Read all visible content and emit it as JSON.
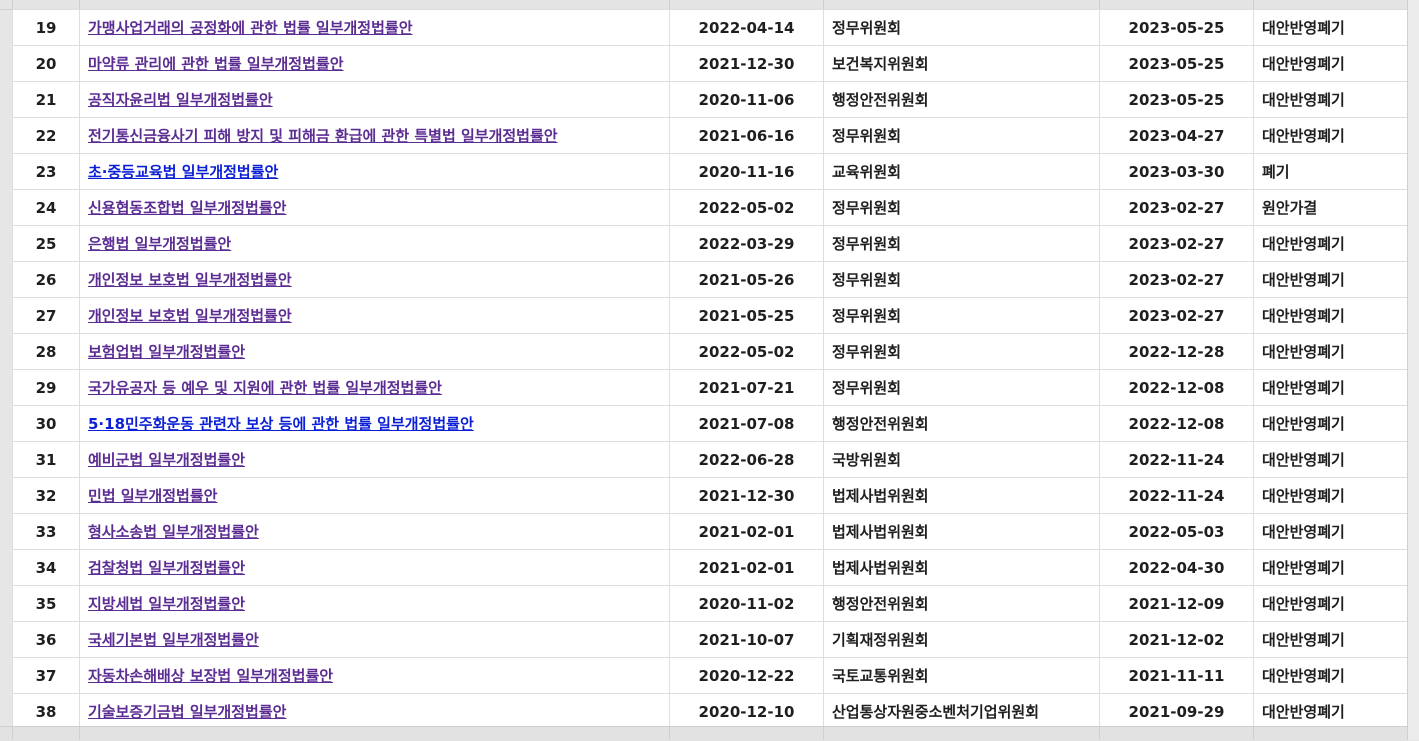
{
  "rows": [
    {
      "no": "19",
      "title": "가맹사업거래의 공정화에 관한 법률 일부개정법률안",
      "proposed": "2022-04-14",
      "committee": "정무위원회",
      "processed": "2023-05-25",
      "result": "대안반영폐기",
      "visited": true
    },
    {
      "no": "20",
      "title": "마약류 관리에 관한 법률 일부개정법률안",
      "proposed": "2021-12-30",
      "committee": "보건복지위원회",
      "processed": "2023-05-25",
      "result": "대안반영폐기",
      "visited": true
    },
    {
      "no": "21",
      "title": "공직자윤리법 일부개정법률안",
      "proposed": "2020-11-06",
      "committee": "행정안전위원회",
      "processed": "2023-05-25",
      "result": "대안반영폐기",
      "visited": true
    },
    {
      "no": "22",
      "title": "전기통신금융사기 피해 방지 및 피해금 환급에 관한 특별법 일부개정법률안",
      "proposed": "2021-06-16",
      "committee": "정무위원회",
      "processed": "2023-04-27",
      "result": "대안반영폐기",
      "visited": true
    },
    {
      "no": "23",
      "title": "초·중등교육법 일부개정법률안",
      "proposed": "2020-11-16",
      "committee": "교육위원회",
      "processed": "2023-03-30",
      "result": "폐기",
      "visited": false
    },
    {
      "no": "24",
      "title": "신용협동조합법 일부개정법률안",
      "proposed": "2022-05-02",
      "committee": "정무위원회",
      "processed": "2023-02-27",
      "result": "원안가결",
      "visited": true
    },
    {
      "no": "25",
      "title": "은행법 일부개정법률안",
      "proposed": "2022-03-29",
      "committee": "정무위원회",
      "processed": "2023-02-27",
      "result": "대안반영폐기",
      "visited": true
    },
    {
      "no": "26",
      "title": "개인정보 보호법 일부개정법률안",
      "proposed": "2021-05-26",
      "committee": "정무위원회",
      "processed": "2023-02-27",
      "result": "대안반영폐기",
      "visited": true
    },
    {
      "no": "27",
      "title": "개인정보 보호법 일부개정법률안",
      "proposed": "2021-05-25",
      "committee": "정무위원회",
      "processed": "2023-02-27",
      "result": "대안반영폐기",
      "visited": true
    },
    {
      "no": "28",
      "title": "보험업법 일부개정법률안",
      "proposed": "2022-05-02",
      "committee": "정무위원회",
      "processed": "2022-12-28",
      "result": "대안반영폐기",
      "visited": true
    },
    {
      "no": "29",
      "title": "국가유공자 등 예우 및 지원에 관한 법률 일부개정법률안",
      "proposed": "2021-07-21",
      "committee": "정무위원회",
      "processed": "2022-12-08",
      "result": "대안반영폐기",
      "visited": true
    },
    {
      "no": "30",
      "title": "5·18민주화운동 관련자 보상 등에 관한 법률 일부개정법률안",
      "proposed": "2021-07-08",
      "committee": "행정안전위원회",
      "processed": "2022-12-08",
      "result": "대안반영폐기",
      "visited": false
    },
    {
      "no": "31",
      "title": "예비군법 일부개정법률안",
      "proposed": "2022-06-28",
      "committee": "국방위원회",
      "processed": "2022-11-24",
      "result": "대안반영폐기",
      "visited": true
    },
    {
      "no": "32",
      "title": "민법 일부개정법률안",
      "proposed": "2021-12-30",
      "committee": "법제사법위원회",
      "processed": "2022-11-24",
      "result": "대안반영폐기",
      "visited": true
    },
    {
      "no": "33",
      "title": "형사소송법 일부개정법률안",
      "proposed": "2021-02-01",
      "committee": "법제사법위원회",
      "processed": "2022-05-03",
      "result": "대안반영폐기",
      "visited": true
    },
    {
      "no": "34",
      "title": "검찰청법 일부개정법률안",
      "proposed": "2021-02-01",
      "committee": "법제사법위원회",
      "processed": "2022-04-30",
      "result": "대안반영폐기",
      "visited": true
    },
    {
      "no": "35",
      "title": "지방세법 일부개정법률안",
      "proposed": "2020-11-02",
      "committee": "행정안전위원회",
      "processed": "2021-12-09",
      "result": "대안반영폐기",
      "visited": true
    },
    {
      "no": "36",
      "title": "국세기본법 일부개정법률안",
      "proposed": "2021-10-07",
      "committee": "기획재정위원회",
      "processed": "2021-12-02",
      "result": "대안반영폐기",
      "visited": true
    },
    {
      "no": "37",
      "title": "자동차손해배상 보장법 일부개정법률안",
      "proposed": "2020-12-22",
      "committee": "국토교통위원회",
      "processed": "2021-11-11",
      "result": "대안반영폐기",
      "visited": true
    },
    {
      "no": "38",
      "title": "기술보증기금법 일부개정법률안",
      "proposed": "2020-12-10",
      "committee": "산업통상자원중소벤처기업위원회",
      "processed": "2021-09-29",
      "result": "대안반영폐기",
      "visited": true
    }
  ]
}
